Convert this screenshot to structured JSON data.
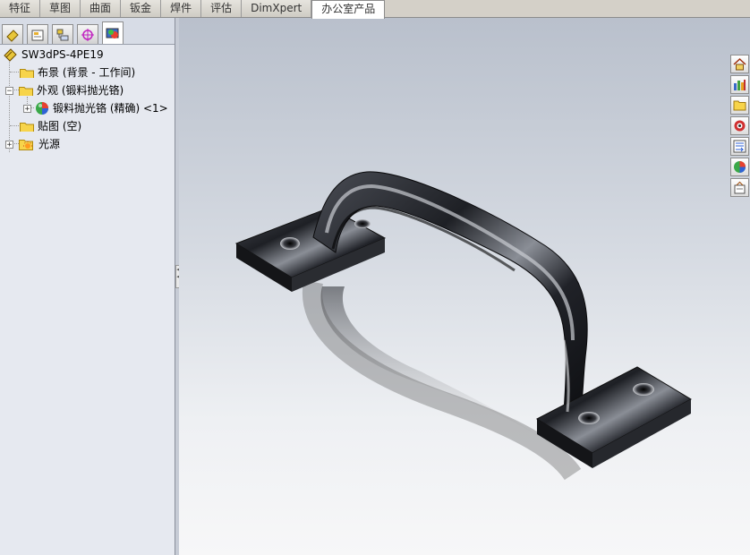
{
  "tabs": [
    "特征",
    "草图",
    "曲面",
    "钣金",
    "焊件",
    "评估",
    "DimXpert",
    "办公室产品"
  ],
  "active_tab": "办公室产品",
  "pane_tabs": [
    "feature-manager-icon",
    "property-manager-icon",
    "configuration-manager-icon",
    "dimxpert-manager-icon",
    "display-manager-icon"
  ],
  "tree": {
    "root": "SW3dPS-4PE19",
    "items": [
      {
        "label": "布景 (背景 - 工作间)"
      },
      {
        "label": "外观 (锻料抛光铬)"
      },
      {
        "label": "锻料抛光铬 (精确) <1>"
      },
      {
        "label": "贴图 (空)"
      },
      {
        "label": "光源"
      }
    ]
  },
  "taskpane": [
    "home-icon",
    "design-library-icon",
    "file-explorer-icon",
    "view-palette-icon",
    "custom-properties-icon",
    "appearances-icon",
    "document-recovery-icon"
  ],
  "colors": {
    "active_tab_bg": "#ffffff",
    "pane_bg": "#e6e9f0",
    "viewport_top": "#b9c0cc",
    "viewport_bottom": "#f7f7f8",
    "chrome": "#2b2d33"
  }
}
